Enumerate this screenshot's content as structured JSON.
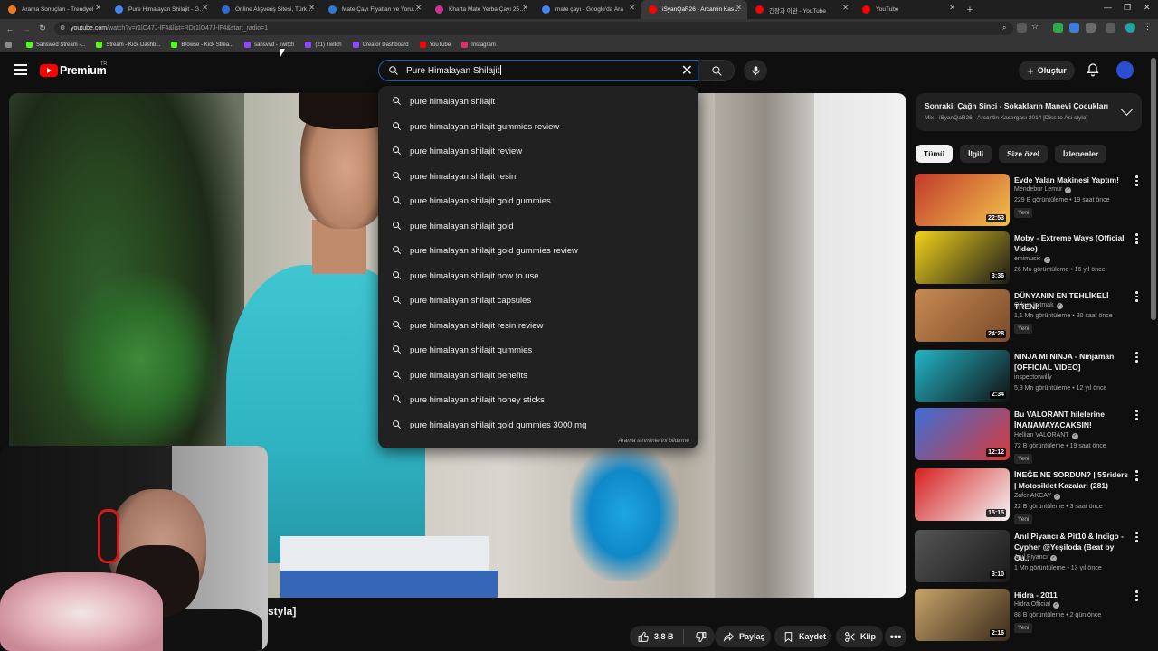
{
  "browser": {
    "tabs": [
      {
        "label": "Arama Sonuçları - Trendyol",
        "color": "#f27a1a"
      },
      {
        "label": "Pure Himalayan Shilajit - Google",
        "color": "#4285f4"
      },
      {
        "label": "Online Alışveriş Sitesi, Türkiye'nin",
        "color": "#2f6bd6"
      },
      {
        "label": "Mate Çayı Fiyatları ve Yorumları",
        "color": "#2e7bd6"
      },
      {
        "label": "Kharta Mate Yerba Çayı 250 G",
        "color": "#d0338f"
      },
      {
        "label": "mate çayı - Google'da Ara",
        "color": "#4285f4"
      },
      {
        "label": "iSyanQaR26 - Arcantin Kasergası",
        "color": "#ff0000"
      },
      {
        "label": "긴장과 이완 - YouTube",
        "color": "#ff0000"
      },
      {
        "label": "YouTube",
        "color": "#ff0000"
      }
    ],
    "active_tab_index": 6,
    "url_host": "youtube.com",
    "url_path": "/watch?v=r1lO47J-lF4&list=RDr1lO47J-lF4&start_radio=1",
    "bookmarks": [
      {
        "label": "Sanswed Stream -...",
        "color": "#53fc18"
      },
      {
        "label": "Stream - Kick Dashb...",
        "color": "#53fc18"
      },
      {
        "label": "Browse - Kick Strea...",
        "color": "#53fc18"
      },
      {
        "label": "sansvvd - Twitch",
        "color": "#9146ff"
      },
      {
        "label": "(21) Twitch",
        "color": "#9146ff"
      },
      {
        "label": "Creator Dashboard",
        "color": "#9146ff"
      },
      {
        "label": "YouTube",
        "color": "#ff0000"
      },
      {
        "label": "Instagram",
        "color": "#e1306c"
      }
    ]
  },
  "masthead": {
    "brand": "Premium",
    "country": "TR",
    "search_value": "Pure Himalayan Shilajit",
    "create_label": "Oluştur"
  },
  "suggestions": {
    "items": [
      "pure himalayan shilajit",
      "pure himalayan shilajit gummies review",
      "pure himalayan shilajit review",
      "pure himalayan shilajit resin",
      "pure himalayan shilajit gold gummies",
      "pure himalayan shilajit gold",
      "pure himalayan shilajit gold gummies review",
      "pure himalayan shilajit how to use",
      "pure himalayan shilajit capsules",
      "pure himalayan shilajit resin review",
      "pure himalayan shilajit gummies",
      "pure himalayan shilajit benefits",
      "pure himalayan shilajit honey sticks",
      "pure himalayan shilajit gold gummies 3000 mg"
    ],
    "report_label": "Arama tahminlerini bildirme"
  },
  "video": {
    "title_tail": "styla]",
    "likes": "3,8 B",
    "share_label": "Paylaş",
    "save_label": "Kaydet",
    "clip_label": "Klip"
  },
  "sidebar": {
    "next_title": "Sonraki: Çağn Sinci - Sokakların Manevi Çocukları",
    "next_sub": "Mix - iSyanQaR26 - Arcantin Kasergası 2014 [Diss to Asi styla]",
    "chips": [
      "Tümü",
      "İlgili",
      "Size özel",
      "İzlenenler"
    ],
    "videos": [
      {
        "title": "Evde Yalan Makinesi Yaptım!",
        "channel": "Mendebur Lemur",
        "verified": true,
        "meta": "229 B görüntüleme • 19 saat önce",
        "badge": "Yeni",
        "duration": "22:53",
        "thumb_a": "#c0392b",
        "thumb_b": "#f3c14b"
      },
      {
        "title": "Moby - Extreme Ways (Official Video)",
        "channel": "emimusic",
        "verified": true,
        "meta": "26 Mn görüntüleme • 16 yıl önce",
        "badge": "",
        "duration": "3:36",
        "thumb_a": "#f2d21b",
        "thumb_b": "#1b1b1b"
      },
      {
        "title": "DÜNYANIN EN TEHLİKELİ TRENİ!",
        "channel": "Orkun Işıtmak",
        "verified": true,
        "meta": "1,1 Mn görüntüleme • 20 saat önce",
        "badge": "Yeni",
        "duration": "24:28",
        "thumb_a": "#c98a52",
        "thumb_b": "#7a4b2a"
      },
      {
        "title": "NINJA MI NINJA - Ninjaman [OFFICIAL VIDEO]",
        "channel": "inspectorwilly",
        "verified": false,
        "meta": "5,3 Mn görüntüleme • 12 yıl önce",
        "badge": "",
        "duration": "2:34",
        "thumb_a": "#23b5c7",
        "thumb_b": "#111111"
      },
      {
        "title": "Bu VALORANT hilelerine İNANAMAYACAKSIN!",
        "channel": "Hellian VALORANT",
        "verified": true,
        "meta": "72 B görüntüleme • 19 saat önce",
        "badge": "Yeni",
        "duration": "12:12",
        "thumb_a": "#3b6fd6",
        "thumb_b": "#d83a3a"
      },
      {
        "title": "İNEĞE NE SORDUN? | 5Sriders | Motosiklet Kazaları (281)",
        "channel": "Zafer AKCAY",
        "verified": true,
        "meta": "22 B görüntüleme • 3 saat önce",
        "badge": "Yeni",
        "duration": "15:15",
        "thumb_a": "#d62020",
        "thumb_b": "#f5f5f5"
      },
      {
        "title": "Anıl Piyancı & Pit10 & Indigo - Cypher @Yeşiloda (Beat by Ou...",
        "channel": "Anıl Piyancı",
        "verified": true,
        "meta": "1 Mn görüntüleme • 13 yıl önce",
        "badge": "",
        "duration": "3:10",
        "thumb_a": "#555555",
        "thumb_b": "#1a1a1a"
      },
      {
        "title": "Hidra - 2011",
        "channel": "Hidra Official",
        "verified": true,
        "meta": "88 B görüntüleme • 2 gün önce",
        "badge": "Yeni",
        "duration": "2:16",
        "thumb_a": "#c7a46a",
        "thumb_b": "#3a2b1a"
      }
    ]
  }
}
